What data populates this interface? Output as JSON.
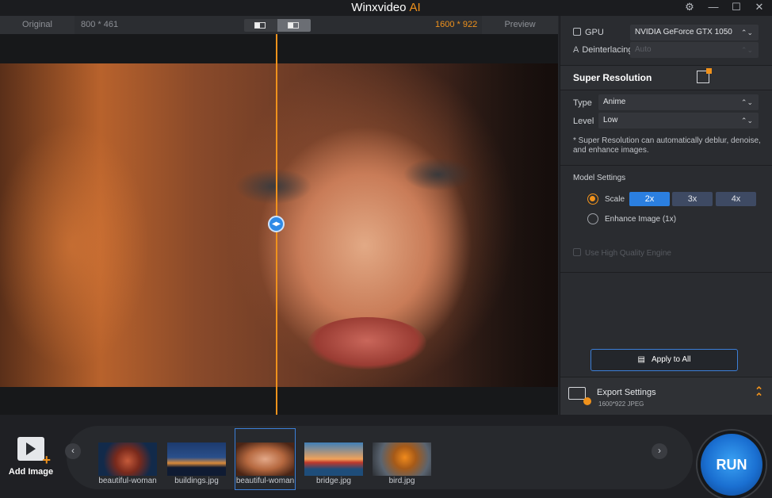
{
  "app": {
    "title": "Winxvideo",
    "title_accent": "AI"
  },
  "window_controls": [
    "gear-icon",
    "minimize-icon",
    "maximize-icon",
    "close-icon"
  ],
  "preview": {
    "original_label": "Original",
    "original_size": "800 * 461",
    "output_size": "1600 * 922",
    "preview_label": "Preview",
    "split_handle_icon": "◂▸"
  },
  "panel": {
    "gpu_label": "GPU",
    "gpu_value": "NVIDIA GeForce GTX 1050",
    "deinterlacing_label": "Deinterlacing",
    "deinterlacing_value": "Auto",
    "section_title": "Super Resolution",
    "type_label": "Type",
    "type_value": "Anime",
    "level_label": "Level",
    "level_value": "Low",
    "note": "* Super Resolution can automatically deblur, denoise, and enhance images.",
    "model_settings_label": "Model Settings",
    "scale_label": "Scale",
    "scale_options": [
      "2x",
      "3x",
      "4x"
    ],
    "scale_selected": "2x",
    "enhance_label": "Enhance Image (1x)",
    "hq_label": "Use High Quality Engine",
    "apply_label": "Apply to All",
    "export_title": "Export Settings",
    "export_detail": "1600*922  JPEG"
  },
  "bottom": {
    "add_image_label": "Add Image",
    "thumbnails": [
      {
        "caption": "beautiful-woman"
      },
      {
        "caption": "buildings.jpg"
      },
      {
        "caption": "beautiful-woman"
      },
      {
        "caption": "bridge.jpg"
      },
      {
        "caption": "bird.jpg"
      }
    ],
    "run_label": "RUN"
  },
  "colors": {
    "accent": "#f0921c",
    "primary": "#2b7fe0"
  }
}
